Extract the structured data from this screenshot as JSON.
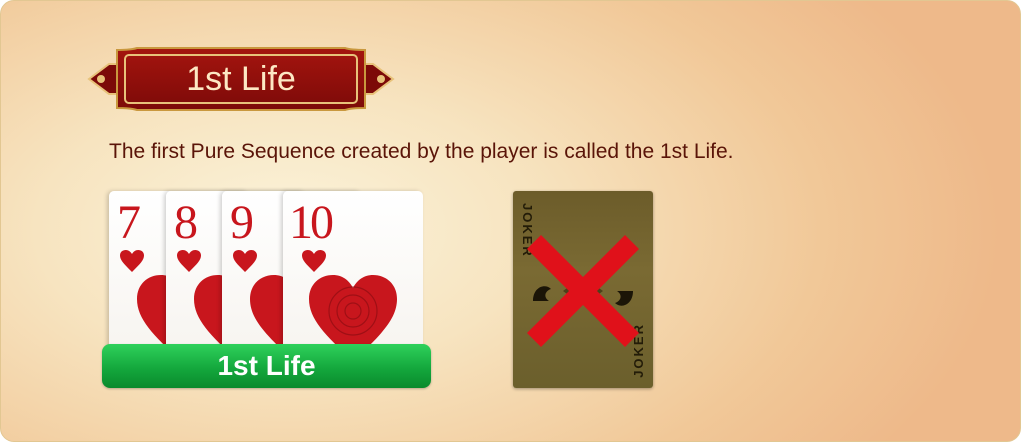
{
  "banner": {
    "title": "1st Life"
  },
  "description": "The first Pure Sequence created by the player is called the 1st Life.",
  "cards": [
    {
      "rank": "7",
      "suit": "hearts"
    },
    {
      "rank": "8",
      "suit": "hearts"
    },
    {
      "rank": "9",
      "suit": "hearts"
    },
    {
      "rank": "10",
      "suit": "hearts"
    }
  ],
  "sequence_label": "1st Life",
  "joker_card": {
    "label": "JOKER",
    "crossed_out": true
  },
  "colors": {
    "banner_fill": "#8b0e0e",
    "banner_border": "#e8c27a",
    "heart_red": "#c8161d",
    "label_green": "#14a83d",
    "cross_red": "#e0111a",
    "text_dark_red": "#5a1408"
  },
  "icons": [
    "heart-icon",
    "cross-mark-icon",
    "joker-figure-icon"
  ]
}
